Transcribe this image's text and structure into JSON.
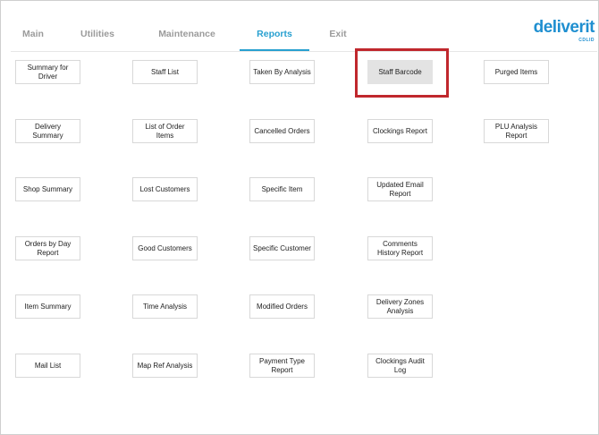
{
  "nav": {
    "tabs": [
      {
        "label": "Main"
      },
      {
        "label": "Utilities"
      },
      {
        "label": "Maintenance"
      },
      {
        "label": "Reports"
      },
      {
        "label": "Exit"
      }
    ]
  },
  "brand": {
    "name": "deliverit",
    "sub": "CDLID"
  },
  "reports": {
    "items": [
      {
        "label": "Summary for Driver"
      },
      {
        "label": "Staff List"
      },
      {
        "label": "Taken By Analysis"
      },
      {
        "label": "Staff Barcode"
      },
      {
        "label": "Purged Items"
      },
      {
        "label": "Delivery Summary"
      },
      {
        "label": "List of Order Items"
      },
      {
        "label": "Cancelled Orders"
      },
      {
        "label": "Clockings Report"
      },
      {
        "label": "PLU Analysis Report"
      },
      {
        "label": "Shop Summary"
      },
      {
        "label": "Lost Customers"
      },
      {
        "label": "Specific Item"
      },
      {
        "label": "Updated Email Report"
      },
      {
        "label": "Orders by Day Report"
      },
      {
        "label": "Good Customers"
      },
      {
        "label": "Specific Customer"
      },
      {
        "label": "Comments History Report"
      },
      {
        "label": "Item Summary"
      },
      {
        "label": "Time Analysis"
      },
      {
        "label": "Modified Orders"
      },
      {
        "label": "Delivery Zones Analysis"
      },
      {
        "label": "Mail List"
      },
      {
        "label": "Map Ref Analysis"
      },
      {
        "label": "Payment Type Report"
      },
      {
        "label": "Clockings Audit Log"
      }
    ]
  },
  "colors": {
    "accent": "#28a0d0",
    "highlight": "#c0272d"
  }
}
